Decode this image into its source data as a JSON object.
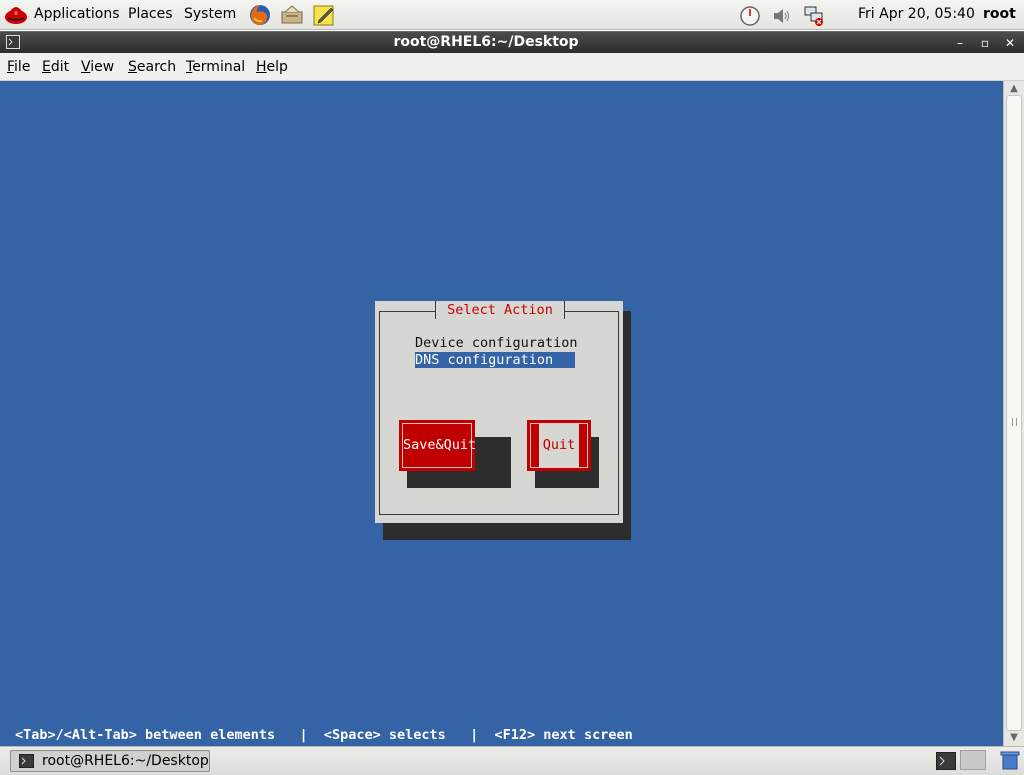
{
  "top_panel": {
    "menus": [
      "Applications",
      "Places",
      "System"
    ],
    "clock": "Fri Apr 20, 05:40",
    "user": "root",
    "launchers": [
      "firefox-icon",
      "mail-client-icon",
      "notes-editor-icon"
    ],
    "tray": [
      "speedometer-icon",
      "volume-icon",
      "network-disconnected-icon"
    ]
  },
  "window": {
    "title": "root@RHEL6:~/Desktop",
    "menus": [
      {
        "mnemonic": "F",
        "rest": "ile"
      },
      {
        "mnemonic": "E",
        "rest": "dit"
      },
      {
        "mnemonic": "V",
        "rest": "iew"
      },
      {
        "mnemonic": "S",
        "rest": "earch"
      },
      {
        "mnemonic": "T",
        "rest": "erminal"
      },
      {
        "mnemonic": "H",
        "rest": "elp"
      }
    ]
  },
  "dialog": {
    "title": "Select Action",
    "items": [
      "Device configuration",
      "DNS configuration"
    ],
    "selected_index": 1,
    "save_quit_label": "Save&Quit",
    "quit_label": "Quit"
  },
  "status_line": "<Tab>/<Alt-Tab> between elements   |  <Space> selects   |  <F12> next screen",
  "taskbar": {
    "task_label": "root@RHEL6:~/Desktop"
  },
  "colors": {
    "terminal_bg": "#3463a6",
    "dialog_bg": "#d6d6d2",
    "button_red": "#c00000",
    "title_red": "#cc0000"
  }
}
